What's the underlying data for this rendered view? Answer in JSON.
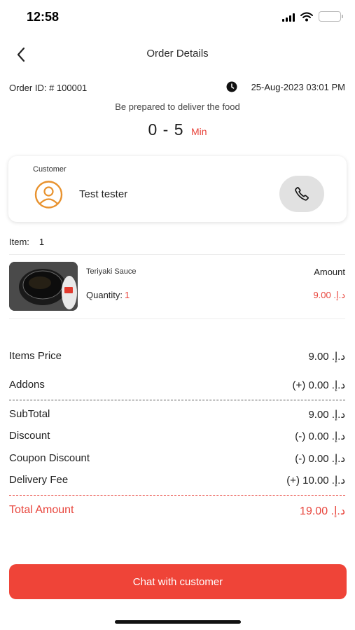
{
  "status_bar": {
    "time": "12:58"
  },
  "header": {
    "title": "Order Details"
  },
  "order": {
    "id_label": "Order ID: # 100001",
    "date": "25-Aug-2023 03:01 PM",
    "prepare_text": "Be prepared to deliver the food",
    "eta_value": "0 - 5",
    "eta_unit": "Min"
  },
  "customer": {
    "caption": "Customer",
    "name": "Test tester"
  },
  "items": {
    "label": "Item:",
    "count": "1",
    "list": [
      {
        "name": "Teriyaki Sauce",
        "amount_label": "Amount",
        "quantity_label": "Quantity:",
        "quantity": "1",
        "price": "9.00 .د.إ"
      }
    ]
  },
  "summary": {
    "items_price": {
      "label": "Items Price",
      "value": "9.00 .د.إ"
    },
    "addons": {
      "label": "Addons",
      "value": "(+) 0.00 .د.إ"
    },
    "subtotal": {
      "label": "SubTotal",
      "value": "9.00 .د.إ"
    },
    "discount": {
      "label": "Discount",
      "value": "(-) 0.00 .د.إ"
    },
    "coupon_discount": {
      "label": "Coupon Discount",
      "value": "(-) 0.00 .د.إ"
    },
    "delivery_fee": {
      "label": "Delivery Fee",
      "value": "(+) 10.00 .د.إ"
    },
    "total_amount": {
      "label": "Total Amount",
      "value": "19.00 .د.إ"
    }
  },
  "actions": {
    "chat_label": "Chat with customer"
  },
  "colors": {
    "accent": "#ef4438",
    "accent_text": "#e8453c",
    "call_bg": "#e1e1e1",
    "avatar": "#e8922e"
  },
  "icons": [
    "back-arrow-icon",
    "clock-icon",
    "user-icon",
    "phone-icon",
    "signal-icon",
    "wifi-icon",
    "battery-icon"
  ]
}
